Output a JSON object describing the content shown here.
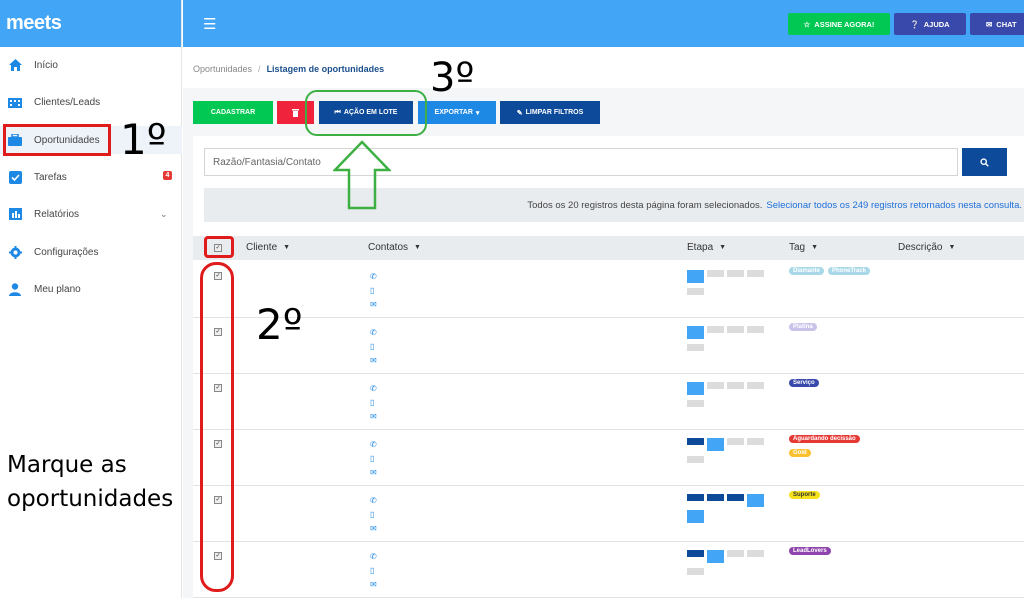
{
  "app": {
    "logo": "meets"
  },
  "sidebar": {
    "items": [
      {
        "label": "Início",
        "icon": "home-icon"
      },
      {
        "label": "Clientes/Leads",
        "icon": "building-icon"
      },
      {
        "label": "Oportunidades",
        "icon": "briefcase-icon"
      },
      {
        "label": "Tarefas",
        "icon": "check-shield-icon",
        "badge": "4"
      },
      {
        "label": "Relatórios",
        "icon": "bar-chart-icon"
      },
      {
        "label": "Configurações",
        "icon": "gear-icon"
      },
      {
        "label": "Meu plano",
        "icon": "user-icon"
      }
    ]
  },
  "topbar": {
    "assine_label": "ASSINE AGORA!",
    "ajuda_label": "AJUDA",
    "chat_label": "CHAT"
  },
  "breadcrumb": {
    "root": "Oportunidades",
    "current": "Listagem de oportunidades"
  },
  "actions": {
    "cadastrar": "CADASTRAR",
    "lote": "AÇÃO EM LOTE",
    "exportar": "EXPORTAR",
    "limpar": "LIMPAR FILTROS"
  },
  "search": {
    "placeholder": "Razão/Fantasia/Contato"
  },
  "notice": {
    "text": "Todos os 20 registros desta página foram selecionados.",
    "link": "Selecionar todos os 249 registros retornados nesta consulta."
  },
  "table": {
    "columns": [
      "Cliente",
      "Contatos",
      "Etapa",
      "Tag",
      "Descrição"
    ],
    "rows": [
      {
        "tags": [
          {
            "text": "Diamante",
            "color": "#a8d8e8",
            "fg": "#fff"
          },
          {
            "text": "PhoneTrack",
            "color": "#a8d8e8",
            "fg": "#fff"
          }
        ],
        "stage": 1
      },
      {
        "tags": [
          {
            "text": "Platina",
            "color": "#c9c3ea",
            "fg": "#fff"
          }
        ],
        "stage": 1
      },
      {
        "tags": [
          {
            "text": "Serviço",
            "color": "#3949ab",
            "fg": "#fff"
          }
        ],
        "stage": 1
      },
      {
        "tags": [
          {
            "text": "Aguardando decissão",
            "color": "#e53935",
            "fg": "#fff"
          },
          {
            "text": "Gold",
            "color": "#fbc02d",
            "fg": "#fff"
          }
        ],
        "stage": 2
      },
      {
        "tags": [
          {
            "text": "Suporte",
            "color": "#f5e21b",
            "fg": "#333"
          }
        ],
        "stage": 4
      },
      {
        "tags": [
          {
            "text": "LeadLovers",
            "color": "#8e44ad",
            "fg": "#fff"
          }
        ],
        "stage": 2
      }
    ]
  },
  "annotations": {
    "first": "1º",
    "second": "2º",
    "third": "3º",
    "marque": "Marque as oportunidades"
  }
}
